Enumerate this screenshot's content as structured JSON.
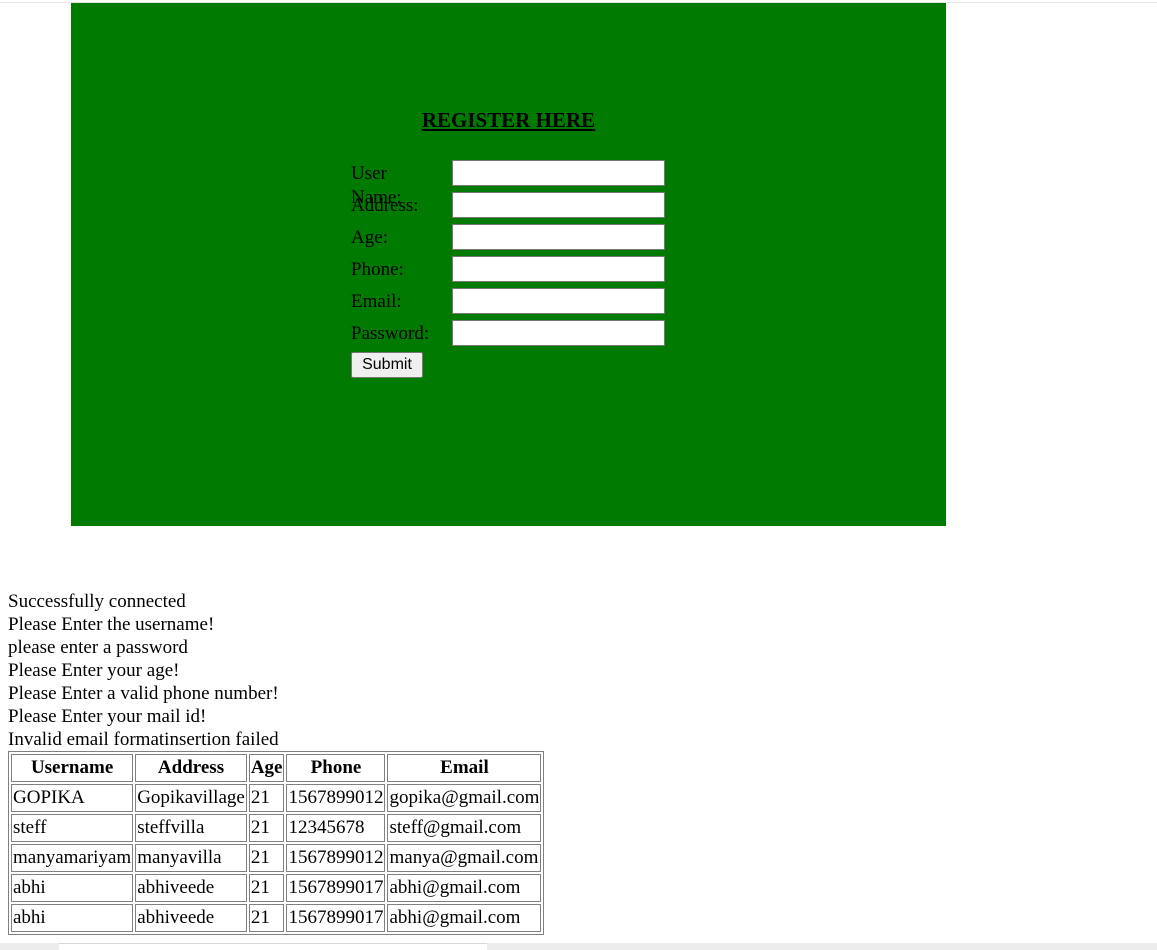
{
  "register": {
    "title": "REGISTER HERE",
    "background_color": "#007a00",
    "fields": [
      {
        "label": "User Name:",
        "value": ""
      },
      {
        "label": "Address:",
        "value": ""
      },
      {
        "label": "Age:",
        "value": ""
      },
      {
        "label": "Phone:",
        "value": ""
      },
      {
        "label": "Email:",
        "value": ""
      },
      {
        "label": "Password:",
        "value": ""
      }
    ],
    "submit_label": "Submit"
  },
  "messages": [
    "Successfully connected",
    "Please Enter the username!",
    "please enter a password",
    "Please Enter your age!",
    "Please Enter a valid phone number!",
    "Please Enter your mail id!",
    "Invalid email formatinsertion failed"
  ],
  "table": {
    "headers": [
      "Username",
      "Address",
      "Age",
      "Phone",
      "Email"
    ],
    "rows": [
      [
        "GOPIKA",
        "Gopikavillage",
        "21",
        "1567899012",
        "gopika@gmail.com"
      ],
      [
        "steff",
        "steffvilla",
        "21",
        "12345678",
        "steff@gmail.com"
      ],
      [
        "manyamariyam",
        "manyavilla",
        "21",
        "1567899012",
        "manya@gmail.com"
      ],
      [
        "abhi",
        "abhiveede",
        "21",
        "1567899017",
        "abhi@gmail.com"
      ],
      [
        "abhi",
        "abhiveede",
        "21",
        "1567899017",
        "abhi@gmail.com"
      ]
    ]
  }
}
